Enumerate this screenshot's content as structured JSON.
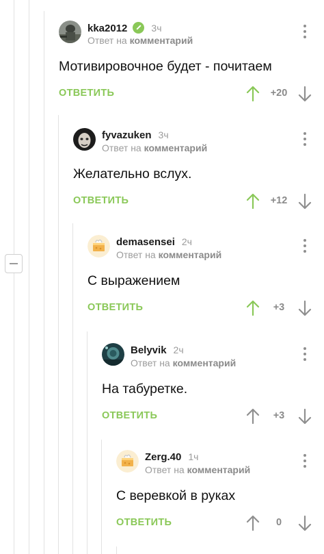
{
  "labels": {
    "reply_action": "ОТВЕТИТЬ",
    "reply_prefix": "Ответ на",
    "reply_target": "комментарий"
  },
  "comments": [
    {
      "author": "kka2012",
      "verified": true,
      "time": "3ч",
      "text": "Мотивировочное будет - почитаем",
      "rating": "+20",
      "upvoted": true,
      "avatar": "soldier-photo-avatar"
    },
    {
      "author": "fyvazuken",
      "verified": false,
      "time": "3ч",
      "text": "Желательно вслух.",
      "rating": "+12",
      "upvoted": true,
      "avatar": "pale-face-avatar"
    },
    {
      "author": "demasensei",
      "verified": false,
      "time": "2ч",
      "text": "С выражением",
      "rating": "+3",
      "upvoted": true,
      "avatar": "cheese-cake-avatar"
    },
    {
      "author": "Belyvik",
      "verified": false,
      "time": "2ч",
      "text": "На табуретке.",
      "rating": "+3",
      "upvoted": false,
      "avatar": "dark-fantasy-avatar"
    },
    {
      "author": "Zerg.40",
      "verified": false,
      "time": "1ч",
      "text": "С веревкой в руках",
      "rating": "0",
      "upvoted": false,
      "avatar": "cheese-cake-avatar"
    }
  ],
  "colors": {
    "accent_green": "#8ac858",
    "muted_gray": "#9b9b9b",
    "thread_line": "#e2e2e2"
  }
}
